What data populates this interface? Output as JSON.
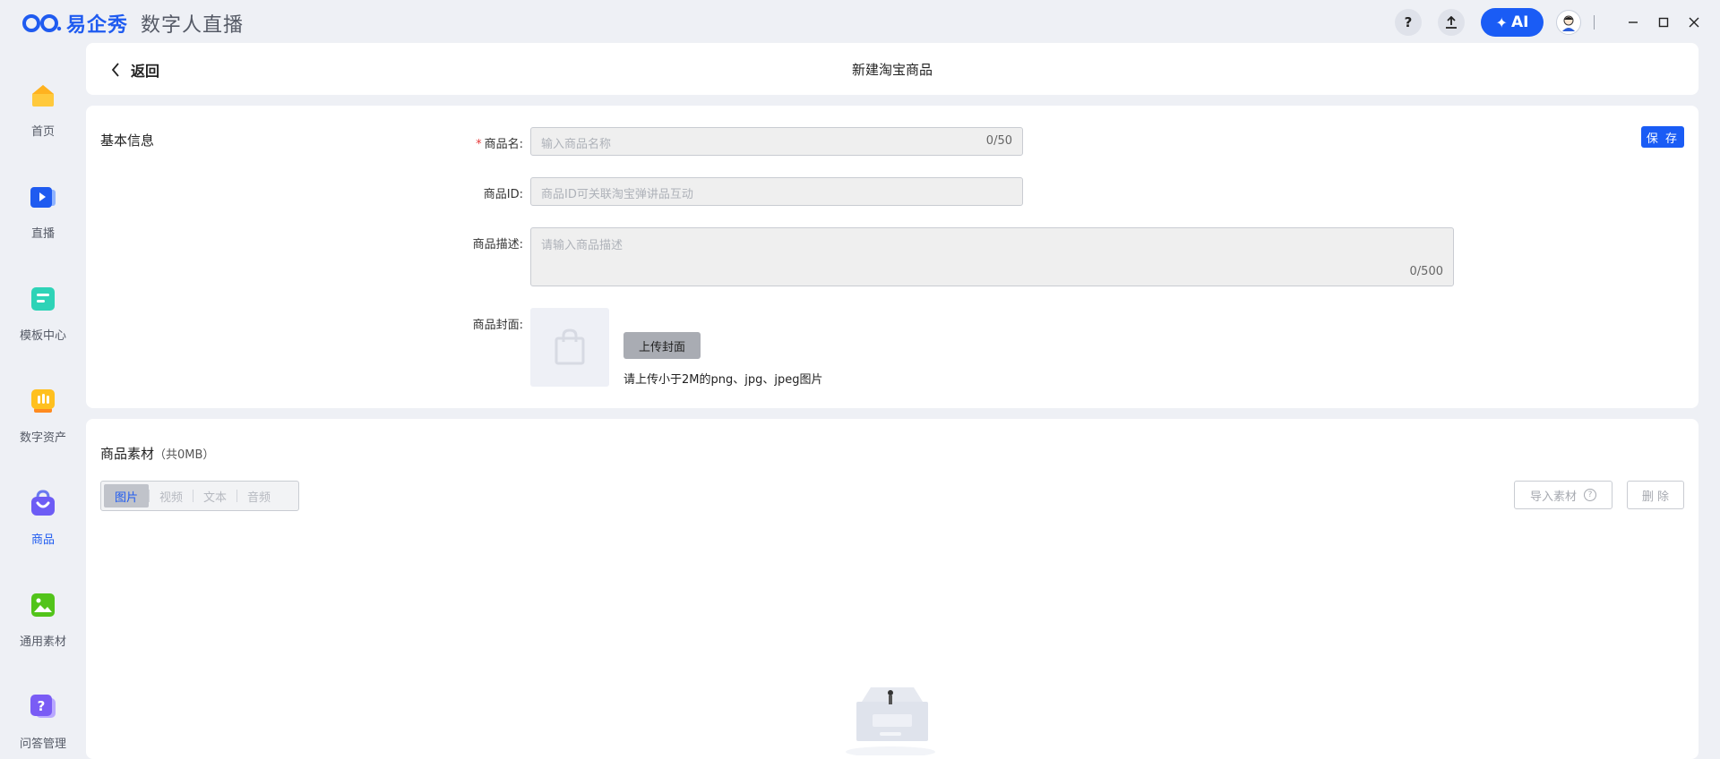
{
  "app": {
    "brand": "易企秀",
    "name": "数字人直播"
  },
  "titlebar": {
    "help_label": "?",
    "ai_label": "AI"
  },
  "sidebar": {
    "items": [
      {
        "label": "首页",
        "icon": "home-icon"
      },
      {
        "label": "直播",
        "icon": "live-icon"
      },
      {
        "label": "模板中心",
        "icon": "template-icon"
      },
      {
        "label": "数字资产",
        "icon": "digital-asset-icon"
      },
      {
        "label": "商品",
        "icon": "product-bag-icon",
        "active": true
      },
      {
        "label": "通用素材",
        "icon": "material-icon"
      },
      {
        "label": "问答管理",
        "icon": "qa-icon"
      }
    ]
  },
  "header": {
    "back_label": "返回",
    "title": "新建淘宝商品"
  },
  "basic_info": {
    "title": "基本信息",
    "save_label": "保 存",
    "name_label": "商品名:",
    "name_required": "*",
    "name_placeholder": "输入商品名称",
    "name_count": "0/50",
    "id_label": "商品ID:",
    "id_placeholder": "商品ID可关联淘宝弹讲品互动",
    "desc_label": "商品描述:",
    "desc_placeholder": "请输入商品描述",
    "desc_count": "0/500",
    "cover_label": "商品封面:",
    "upload_label": "上传封面",
    "upload_hint": "请上传小于2M的png、jpg、jpeg图片"
  },
  "materials": {
    "title": "商品素材",
    "subtitle": "（共0MB）",
    "tabs": [
      "图片",
      "视频",
      "文本",
      "音频"
    ],
    "active_tab": "图片",
    "import_label": "导入素材",
    "delete_label": "删 除"
  },
  "colors": {
    "accent": "#1a5cf5",
    "background": "#eef0f5"
  }
}
